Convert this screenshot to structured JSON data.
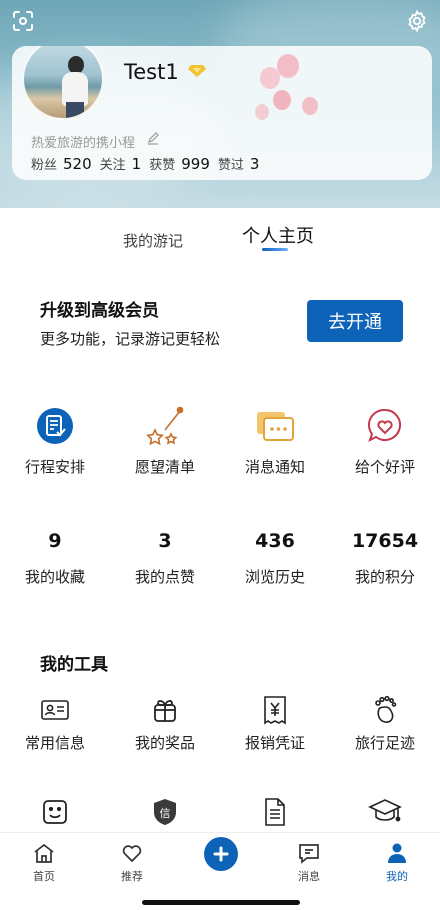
{
  "profile": {
    "username": "Test1",
    "signature": "热爱旅游的携小程",
    "stats": [
      {
        "label": "粉丝",
        "value": "520"
      },
      {
        "label": "关注",
        "value": "1"
      },
      {
        "label": "获赞",
        "value": "999"
      },
      {
        "label": "赞过",
        "value": "3"
      }
    ]
  },
  "tabs": {
    "travel": "我的游记",
    "home": "个人主页"
  },
  "upgrade": {
    "title": "升级到高级会员",
    "subtitle": "更多功能，记录游记更轻松",
    "button": "去开通"
  },
  "actions": [
    {
      "label": "行程安排",
      "icon": "itinerary-icon"
    },
    {
      "label": "愿望清单",
      "icon": "wishlist-icon"
    },
    {
      "label": "消息通知",
      "icon": "message-icon"
    },
    {
      "label": "给个好评",
      "icon": "heart-chat-icon"
    }
  ],
  "counts": [
    {
      "value": "9",
      "label": "我的收藏"
    },
    {
      "value": "3",
      "label": "我的点赞"
    },
    {
      "value": "436",
      "label": "浏览历史"
    },
    {
      "value": "17654",
      "label": "我的积分"
    }
  ],
  "tools": {
    "title": "我的工具",
    "items": [
      {
        "label": "常用信息",
        "icon": "id-card-icon"
      },
      {
        "label": "我的奖品",
        "icon": "gift-icon"
      },
      {
        "label": "报销凭证",
        "icon": "receipt-icon"
      },
      {
        "label": "旅行足迹",
        "icon": "footprint-icon"
      }
    ],
    "row2_icons": [
      "smile-icon",
      "credit-badge-icon",
      "document-icon",
      "graduation-cap-icon"
    ],
    "credit_badge_char": "信"
  },
  "tabbar": {
    "home": "首页",
    "recommend": "推荐",
    "messages": "消息",
    "me": "我的"
  },
  "colors": {
    "accent": "#0d63b7",
    "wish_orange": "#c8702a",
    "message_yellow": "#e0a43a",
    "review_red": "#c23a4e"
  }
}
